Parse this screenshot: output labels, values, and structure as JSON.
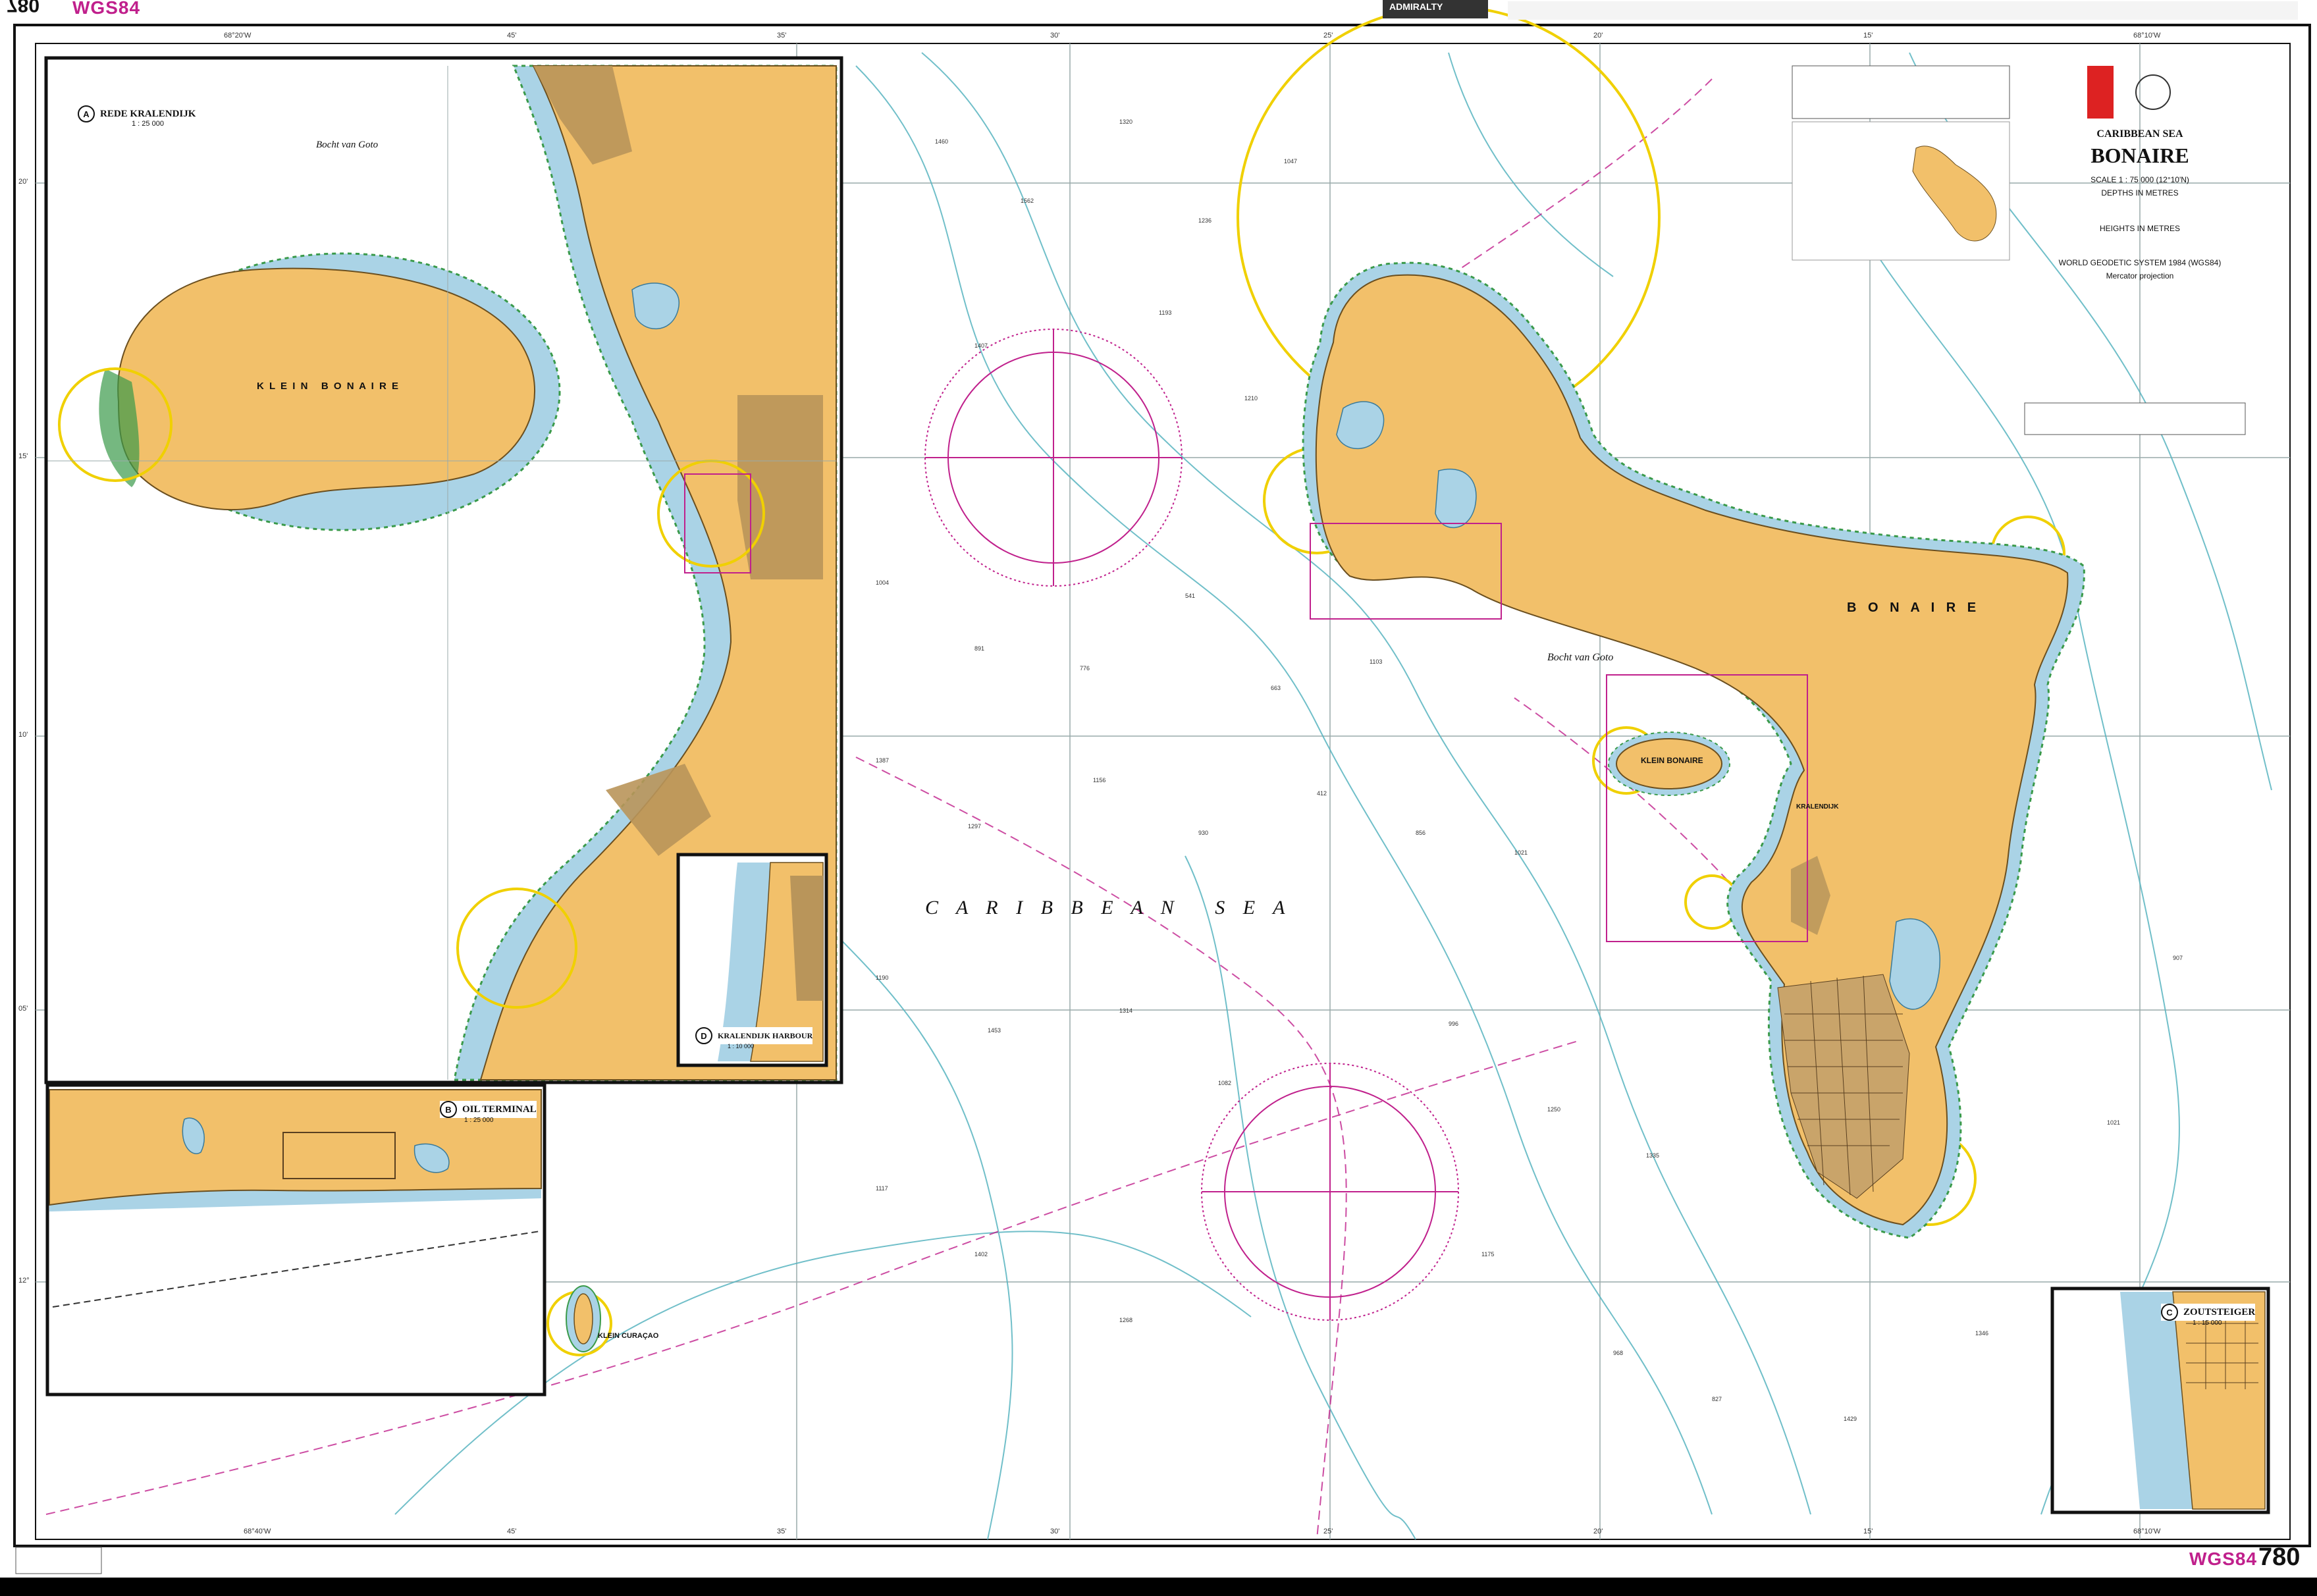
{
  "header": {
    "chart_number_top": "780",
    "datum_top": "WGS84",
    "publisher_label": "ADMIRALTY"
  },
  "footer": {
    "datum_bottom": "WGS84",
    "chart_number_bottom": "780"
  },
  "title_block": {
    "region": "CARIBBEAN SEA",
    "title": "BONAIRE",
    "scale": "SCALE 1 : 75 000 (12°10'N)",
    "depths": "DEPTHS IN METRES",
    "heights": "HEIGHTS IN METRES",
    "datum": "WORLD GEODETIC SYSTEM 1984 (WGS84)",
    "projection": "Mercator projection"
  },
  "map_labels": {
    "sea": "C A R I B B E A N   S E A",
    "bonaire": "B O N A I R E",
    "klein_bonaire_main": "KLEIN BONAIRE",
    "bocht_van_goto": "Bocht van Goto",
    "kralendijk": "KRALENDIJK",
    "klein_curacao": "KLEIN CURAÇAO"
  },
  "insets": {
    "A": {
      "letter": "A",
      "title": "REDE KRALENDIJK",
      "scale": "1 : 25 000",
      "klein_bonaire": "K L E I N   B O N A I R E",
      "bocht": "Bocht van Goto"
    },
    "B": {
      "letter": "B",
      "title": "OIL TERMINAL",
      "scale": "1 : 25 000"
    },
    "C": {
      "letter": "C",
      "title": "ZOUTSTEIGER",
      "scale": "1 : 15 000"
    },
    "D": {
      "letter": "D",
      "title": "KRALENDIJK HARBOUR",
      "scale": "1 : 10 000"
    }
  },
  "graticule": {
    "top_lons": [
      "68°20'W",
      "45'",
      "35'",
      "30'",
      "25'",
      "20'",
      "15'",
      "68°10'W"
    ],
    "bottom_lons": [
      "68°40'W",
      "45'",
      "35'",
      "30'",
      "25'",
      "20'",
      "15'",
      "68°10'W"
    ],
    "lats": [
      "20'",
      "15'",
      "10'",
      "05'",
      "12°"
    ]
  },
  "soundings": [
    "1460",
    "1562",
    "1320",
    "1236",
    "1047",
    "1407",
    "1193",
    "1210",
    "1004",
    "891",
    "776",
    "541",
    "663",
    "1103",
    "1387",
    "1297",
    "1156",
    "930",
    "412",
    "856",
    "1021",
    "1190",
    "1453",
    "1314",
    "1082",
    "996",
    "1250",
    "1335",
    "1117",
    "1402",
    "1268",
    "1175",
    "968",
    "827",
    "1429",
    "1346",
    "1021",
    "907"
  ],
  "colors": {
    "land": "#f2c06a",
    "land_dark": "#b9955a",
    "shallow": "#aad3e6",
    "reef_green": "#3a9a4a",
    "magenta": "#c0208c",
    "yellow_light": "#f0d000",
    "contour": "#58b4c0"
  }
}
